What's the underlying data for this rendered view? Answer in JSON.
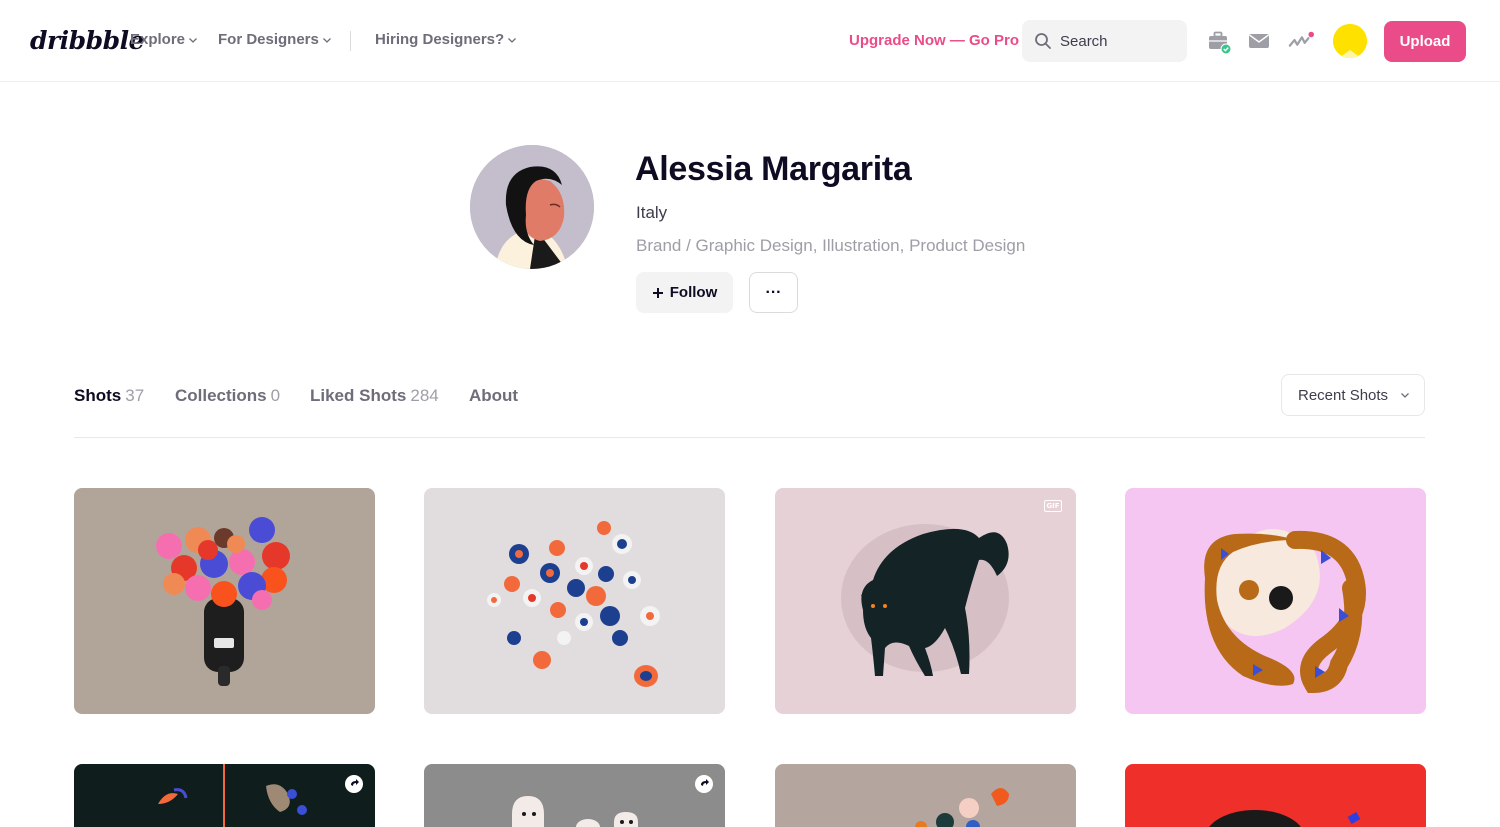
{
  "header": {
    "logo": "dribbble",
    "nav": [
      {
        "label": "Explore"
      },
      {
        "label": "For Designers"
      },
      {
        "label": "Hiring Designers?"
      }
    ],
    "upgrade": "Upgrade Now — Go Pro",
    "search_placeholder": "Search",
    "upload_label": "Upload",
    "icons": [
      "briefcase-icon",
      "mail-icon",
      "activity-icon"
    ],
    "accent_color": "#ea4c89"
  },
  "profile": {
    "name": "Alessia Margarita",
    "location": "Italy",
    "skills": "Brand / Graphic Design, Illustration, Product Design",
    "follow_label": "Follow",
    "more_label": "···"
  },
  "tabs": [
    {
      "label": "Shots",
      "count": "37"
    },
    {
      "label": "Collections",
      "count": "0"
    },
    {
      "label": "Liked Shots",
      "count": "284"
    },
    {
      "label": "About",
      "count": ""
    }
  ],
  "sort": {
    "selected": "Recent Shots"
  },
  "shots": [
    {
      "subject": "balloons-moped",
      "bg": "#b1a59a"
    },
    {
      "subject": "marbles",
      "bg": "#e1dcdd"
    },
    {
      "subject": "black-cat",
      "bg": "#e5d1d6",
      "badge": "GIF"
    },
    {
      "subject": "snake-skull",
      "bg": "#f5c6f1"
    },
    {
      "subject": "insects",
      "bg": "#0f1e1d"
    },
    {
      "subject": "ghosts",
      "bg": "#8b8c8b"
    },
    {
      "subject": "dots",
      "bg": "#b5a59f"
    },
    {
      "subject": "red",
      "bg": "#ee2f2a"
    }
  ]
}
